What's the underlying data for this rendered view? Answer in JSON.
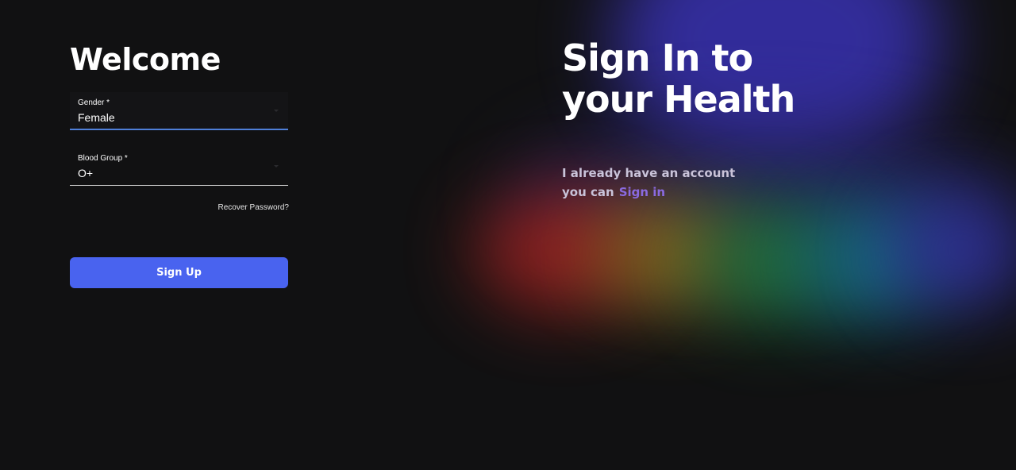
{
  "form": {
    "heading": "Welcome",
    "gender": {
      "label": "Gender *",
      "value": "Female"
    },
    "blood_group": {
      "label": "Blood Group *",
      "value": "O+"
    },
    "recover_link": "Recover Password?",
    "submit_label": "Sign Up"
  },
  "hero": {
    "title_line1": "Sign In to",
    "title_line2": "your Health",
    "account_line1": "I already have an account",
    "account_line2_prefix": "you can",
    "signin_link": "Sign in"
  },
  "colors": {
    "background": "#111112",
    "accent_button": "#4963ef",
    "focus_underline": "#4f7fd8",
    "signin_link": "#8a6ae0",
    "glow": [
      "#3a33b8",
      "#a3231f",
      "#8c7417",
      "#1e7d3a",
      "#147287",
      "#3232a0"
    ]
  }
}
